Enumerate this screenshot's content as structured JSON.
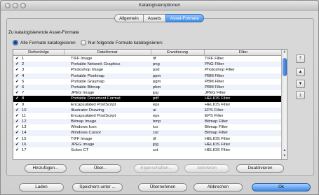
{
  "window": {
    "title": "Katalogisieroptionen"
  },
  "tabs": [
    {
      "label": "Allgemein",
      "active": false
    },
    {
      "label": "Assets",
      "active": false
    },
    {
      "label": "Asset-Formate",
      "active": true
    }
  ],
  "section": {
    "title": "Zu katalogisierende Asset-Formate",
    "radio_all": "Alle Formate katalogisieren",
    "radio_none": "Nur folgende Formate katalogisieren:",
    "selected_radio": "all"
  },
  "table": {
    "columns": [
      "Reihenfolge",
      "Dateiformat",
      "Erweiterung",
      "Filter"
    ],
    "rows": [
      {
        "checked": true,
        "order": "1",
        "format": "TIFF Image",
        "ext": "tif",
        "filter": "TIFF Filter"
      },
      {
        "checked": true,
        "order": "2",
        "format": "Portable Network Graphics",
        "ext": "png",
        "filter": "PNG Filter"
      },
      {
        "checked": true,
        "order": "3",
        "format": "Photoshop Image",
        "ext": "psd",
        "filter": "Photoshop Filter"
      },
      {
        "checked": true,
        "order": "4",
        "format": "Portable Pixelmap",
        "ext": "ppm",
        "filter": "PBM Filter"
      },
      {
        "checked": true,
        "order": "5",
        "format": "Portable Graymap",
        "ext": "pgm",
        "filter": "PBM Filter"
      },
      {
        "checked": true,
        "order": "6",
        "format": "Portable Bitmap",
        "ext": "pbm",
        "filter": "PBM Filter"
      },
      {
        "checked": true,
        "order": "7",
        "format": "JPEG Image",
        "ext": "jpg",
        "filter": "JPEG Filter"
      },
      {
        "checked": true,
        "order": "8",
        "format": "Portable Document Format",
        "ext": "pdf",
        "filter": "HELIOS Filter",
        "selected": true
      },
      {
        "checked": true,
        "order": "9",
        "format": "Encapsulated PostScript",
        "ext": "eps",
        "filter": "HELIOS Filter"
      },
      {
        "checked": true,
        "order": "10",
        "format": "Illustrator Drawing",
        "ext": "ai",
        "filter": "EPS Filter"
      },
      {
        "checked": true,
        "order": "11",
        "format": "Encapsulated PostScript",
        "ext": "eps",
        "filter": "EPS Filter"
      },
      {
        "checked": true,
        "order": "12",
        "format": "Bitmap Image",
        "ext": "bmp",
        "filter": "Bitmap Filter"
      },
      {
        "checked": true,
        "order": "13",
        "format": "Windows Icon",
        "ext": "ico",
        "filter": "Bitmap Filter"
      },
      {
        "checked": true,
        "order": "14",
        "format": "Windows Cursor",
        "ext": "cur",
        "filter": "Bitmap Filter"
      },
      {
        "checked": true,
        "order": "15",
        "format": "TIFF Image",
        "ext": "tif",
        "filter": "HELIOS Filter"
      },
      {
        "checked": true,
        "order": "16",
        "format": "JPEG Image",
        "ext": "jpg",
        "filter": "HELIOS Filter"
      },
      {
        "checked": true,
        "order": "17",
        "format": "Scitex CT",
        "ext": "sct",
        "filter": "HELIOS Filter"
      }
    ]
  },
  "side_buttons": [
    {
      "icon": "move-to-top-icon",
      "glyph": "⤒"
    },
    {
      "icon": "move-up-icon",
      "glyph": "▲"
    },
    {
      "icon": "move-down-icon",
      "glyph": "▼"
    },
    {
      "icon": "move-to-bottom-icon",
      "glyph": "⤓"
    }
  ],
  "actions": {
    "add": "Hinzufügen...",
    "about": "Über...",
    "properties": "Eigenschaften...",
    "activate": "Aktivieren",
    "deactivate": "Deaktivieren"
  },
  "footer": {
    "load": "Laden",
    "save_as": "Speichern unter ...",
    "apply": "Übernehmen",
    "cancel": "Abbrechen",
    "ok": "Ok"
  },
  "colors": {
    "accent": "#3f8fe8",
    "selection": "#000000",
    "row_alt": "#eef3fb"
  }
}
